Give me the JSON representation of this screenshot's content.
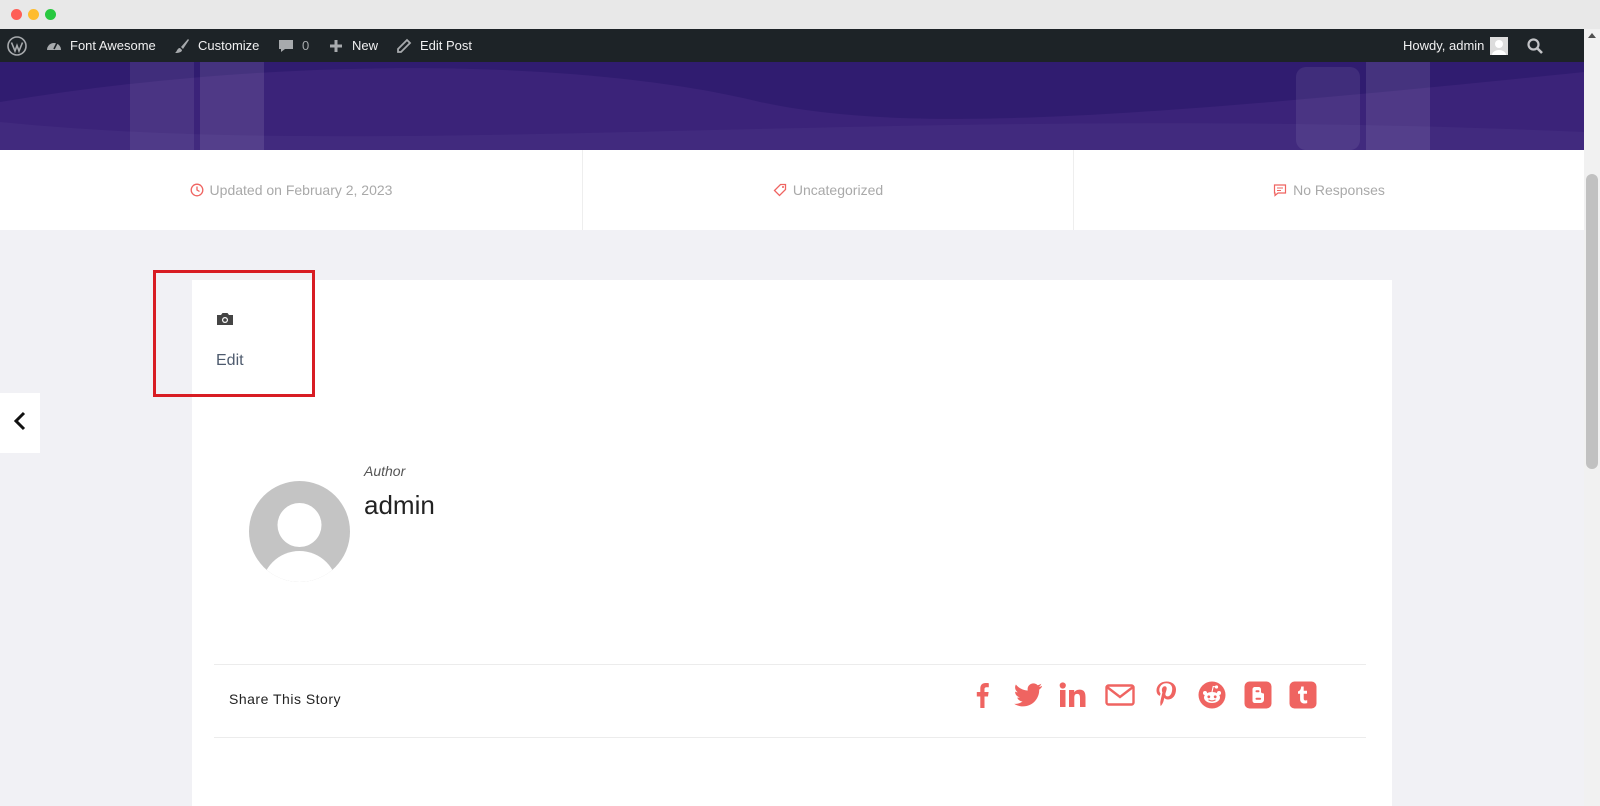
{
  "adminbar": {
    "site_name": "Font Awesome",
    "customize": "Customize",
    "comments_count": "0",
    "new_label": "New",
    "edit_post": "Edit Post",
    "howdy": "Howdy, admin"
  },
  "meta": {
    "updated": "Updated on February 2, 2023",
    "category": "Uncategorized",
    "responses": "No Responses"
  },
  "post": {
    "edit_link": "Edit"
  },
  "author": {
    "label": "Author",
    "name": "admin"
  },
  "share": {
    "label": "Share This Story",
    "networks": [
      "facebook",
      "twitter",
      "linkedin",
      "email",
      "pinterest",
      "reddit",
      "blogger",
      "tumblr"
    ]
  },
  "colors": {
    "accent": "#ef6461",
    "admin_bar": "#1d2327",
    "hero": "#3b2379",
    "highlight": "#d81c23"
  }
}
